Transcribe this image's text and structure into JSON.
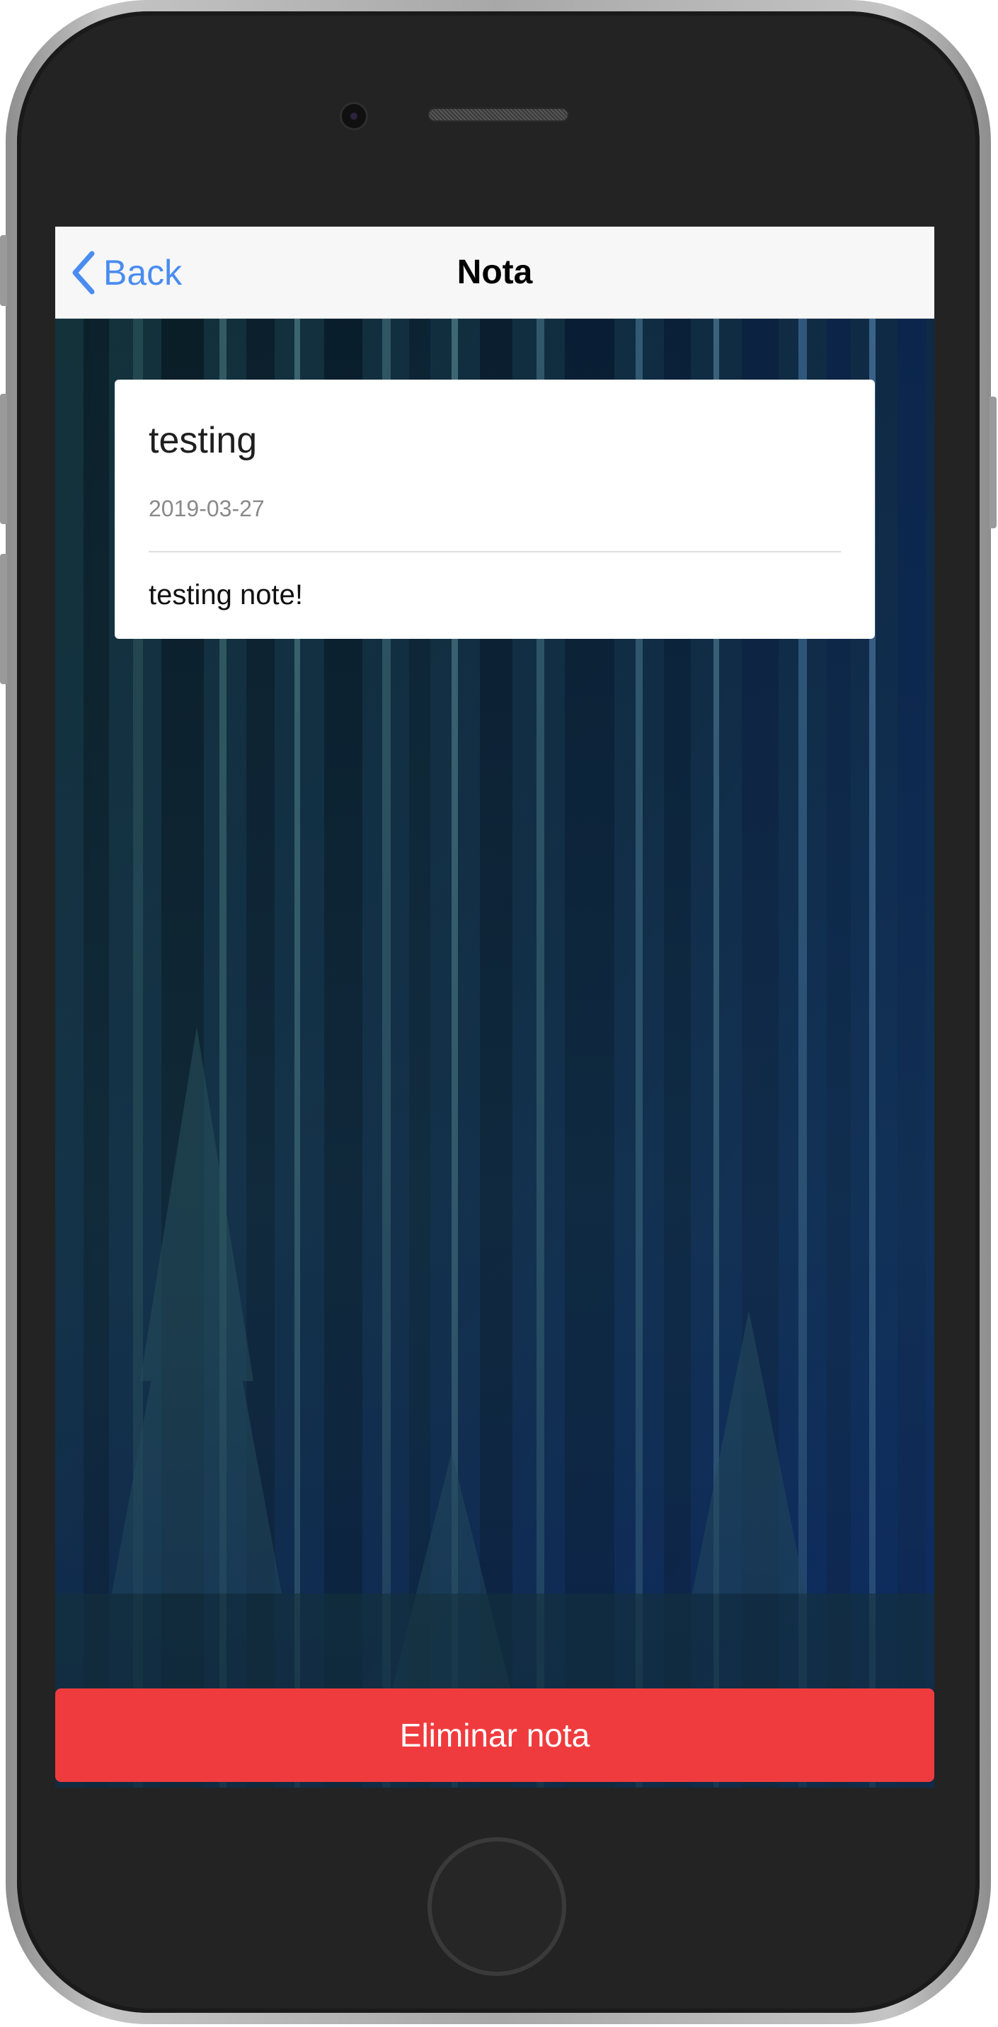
{
  "navbar": {
    "back_label": "Back",
    "title": "Nota"
  },
  "note": {
    "title": "testing",
    "date": "2019-03-27",
    "body": "testing note!"
  },
  "actions": {
    "delete_label": "Eliminar nota"
  },
  "colors": {
    "nav_link": "#4a8cf0",
    "delete_button": "#f03b3e",
    "navbar_bg": "#f7f7f7"
  },
  "icons": {
    "back": "chevron-left-icon"
  }
}
